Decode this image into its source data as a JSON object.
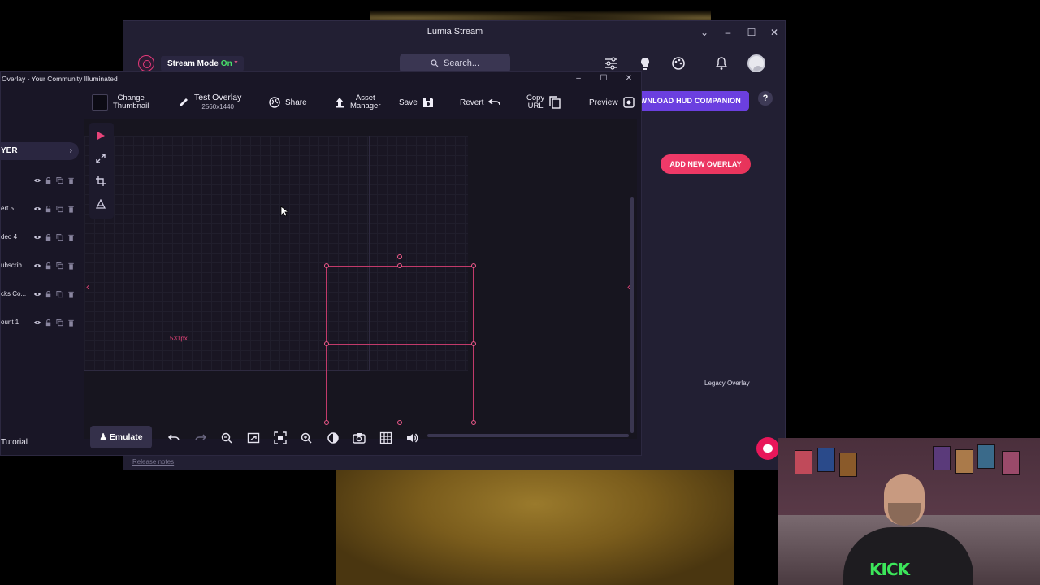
{
  "lumia": {
    "window_title": "Lumia Stream",
    "stream_mode_label": "Stream Mode",
    "stream_mode_state": "On",
    "search_placeholder": "Search...",
    "hud_button": "WNLOAD HUD COMPANION",
    "help_label": "?",
    "add_overlay_button": "ADD NEW OVERLAY",
    "legacy_overlay": "Legacy Overlay",
    "release_notes": "Release notes",
    "accent_color": "#e8175a"
  },
  "editor": {
    "window_title": "Overlay - Your Community Illuminated",
    "toolbar": {
      "change_thumbnail_line1": "Change",
      "change_thumbnail_line2": "Thumbnail",
      "test_overlay": "Test Overlay",
      "resolution": "2560x1440",
      "share": "Share",
      "asset_manager_line1": "Asset",
      "asset_manager_line2": "Manager",
      "save": "Save",
      "revert": "Revert",
      "copy_url_line1": "Copy",
      "copy_url_line2": "URL",
      "preview": "Preview"
    },
    "layers": {
      "header": "YER",
      "items": [
        {
          "label": ""
        },
        {
          "label": "ert 5"
        },
        {
          "label": "deo 4"
        },
        {
          "label": "ubscrib..."
        },
        {
          "label": "cks Co..."
        },
        {
          "label": "ount 1"
        }
      ],
      "tutorial": "Tutorial"
    },
    "canvas": {
      "measure_label": "531px"
    },
    "bottom_toolbar": {
      "emulate": "Emulate"
    }
  },
  "webcam": {
    "shirt_text": "KICK"
  }
}
